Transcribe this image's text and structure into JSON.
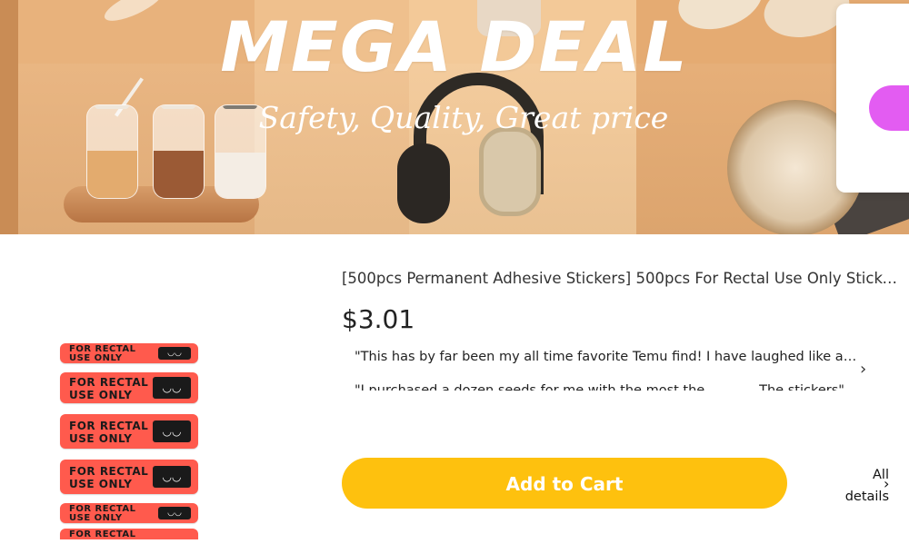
{
  "banner": {
    "title": "MEGA DEAL",
    "subtitle": "Safety, Quality, Great price",
    "colors": {
      "background": "#e8b27b",
      "text": "#ffffff",
      "side_pill": "#e35cf2"
    }
  },
  "product": {
    "title": "[500pcs Permanent Adhesive Stickers] 500pcs For Rectal Use Only Stickers - ...",
    "price": "$3.01",
    "image_sticker_text_line1": "FOR RECTAL",
    "image_sticker_text_line2": "USE ONLY",
    "image_sticker_color": "#ff5a4d",
    "reviews": [
      "\"This has by far been my all time favorite Temu find! I have laughed like a 12...\"",
      "\"I purchased a dozen seeds for me with the most the ... ... ... The stickers\""
    ],
    "reviews_chevron": "›"
  },
  "actions": {
    "add_to_cart": "Add to Cart",
    "add_to_cart_color": "#fec10e",
    "all_details_line1": "All",
    "all_details_line2": "details",
    "all_details_chevron": "›"
  }
}
